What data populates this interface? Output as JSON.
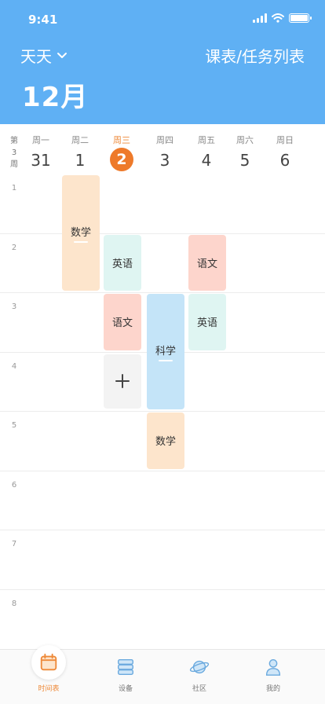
{
  "status": {
    "time": "9:41"
  },
  "header": {
    "child_name": "天天",
    "list_link": "课表/任务列表",
    "month": "12月"
  },
  "week": {
    "label_chars": [
      "第",
      "3",
      "周"
    ],
    "days": [
      {
        "name": "周一",
        "num": "31"
      },
      {
        "name": "周二",
        "num": "1"
      },
      {
        "name": "周三",
        "num": "2",
        "today": true
      },
      {
        "name": "周四",
        "num": "3"
      },
      {
        "name": "周五",
        "num": "4"
      },
      {
        "name": "周六",
        "num": "5"
      },
      {
        "name": "周日",
        "num": "6"
      }
    ]
  },
  "periods": [
    "1",
    "2",
    "3",
    "4",
    "5",
    "6",
    "7",
    "8"
  ],
  "courses": [
    {
      "name": "数学",
      "day": 1,
      "start": 1,
      "end": 2,
      "color": "#fde5cc",
      "underline": true
    },
    {
      "name": "英语",
      "day": 2,
      "start": 2,
      "end": 2,
      "color": "#dff5f2"
    },
    {
      "name": "语文",
      "day": 2,
      "start": 3,
      "end": 3,
      "color": "#fdd5cc"
    },
    {
      "name": "科学",
      "day": 3,
      "start": 3,
      "end": 4,
      "color": "#c4e4f8",
      "underline": true
    },
    {
      "name": "数学",
      "day": 3,
      "start": 5,
      "end": 5,
      "color": "#fde5cc"
    },
    {
      "name": "语文",
      "day": 4,
      "start": 2,
      "end": 2,
      "color": "#fdd5cc"
    },
    {
      "name": "英语",
      "day": 4,
      "start": 3,
      "end": 3,
      "color": "#dff5f2"
    }
  ],
  "add_cell": {
    "day": 2,
    "period": 4
  },
  "tabs": [
    {
      "label": "时间表",
      "icon": "calendar-icon",
      "active": true
    },
    {
      "label": "设备",
      "icon": "device-icon"
    },
    {
      "label": "社区",
      "icon": "planet-icon"
    },
    {
      "label": "我的",
      "icon": "profile-icon"
    }
  ],
  "colors": {
    "header": "#5fb0f4",
    "accent": "#ee7a2a"
  }
}
